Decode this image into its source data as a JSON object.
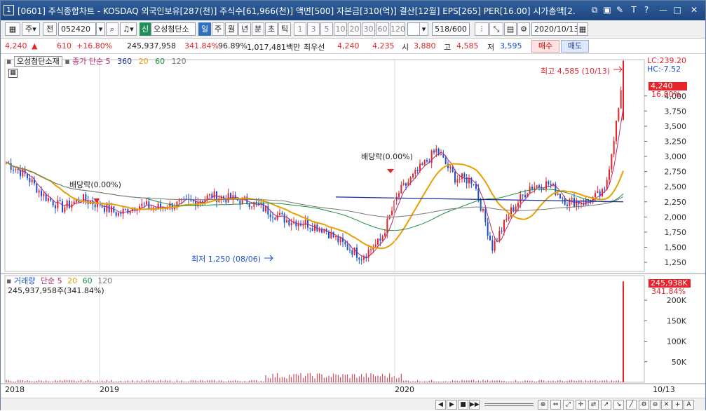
{
  "title": {
    "number": "1",
    "text": "[0601] 주식종합차트 - KOSDAQ 외국인보유[287(천)] 주식수[61,966(천)] 액면[500] 자본금[310(억)] 결산[12월] EPS[265] PER[16.00] 시가총액[2.",
    "buttons": [
      "⧉",
      "▣",
      "✎",
      "T",
      "?",
      "—",
      "□",
      "✕"
    ]
  },
  "toolbar": {
    "period_type": "주",
    "all_label": "전",
    "code": "052420",
    "stock_badge": "신",
    "stock_name": "오성첨단소",
    "periods": [
      "일",
      "주",
      "월",
      "년",
      "분",
      "초",
      "틱"
    ],
    "minute_steps": [
      "1",
      "3",
      "5",
      "10",
      "20",
      "30",
      "60",
      "120"
    ],
    "count": "518",
    "count_total": "/600",
    "date": "2020/10/13"
  },
  "quote": {
    "price": "4,240",
    "arrow": "▲",
    "change": "610",
    "change_pct": "+16.80%",
    "volume": "245,937,958",
    "volume_pct": "341.84%",
    "ratio": "96.89%",
    "amount": "1,017,481백만",
    "best_label": "최우선",
    "ask": "4,240",
    "bid": "4,235",
    "open_label": "시",
    "open": "3,880",
    "high_label": "고",
    "high": "4,585",
    "low_label": "저",
    "low": "3,595",
    "buy_label": "매수",
    "sell_label": "매도"
  },
  "price_panel": {
    "stock_tab": "오성첨단소재",
    "indicator_label": "종가 단순",
    "ma_periods": [
      "5",
      "360",
      "20",
      "60",
      "120"
    ],
    "lc": "LC:239.20",
    "hc": "HC:-7.52",
    "current_price": "4,240",
    "current_pct": "16.80%",
    "annotations": {
      "high": "최고 4,585 (10/13)",
      "low": "최저 1,250 (08/06)",
      "div1": "배당락(0.00%)",
      "div2": "배당락(0.00%)"
    }
  },
  "volume_panel": {
    "label": "거래량",
    "indicator_label": "단순",
    "ma_periods": [
      "5",
      "20",
      "60",
      "120"
    ],
    "value": "245,937,958주(341.84%)",
    "current": "245,938K",
    "current_pct": "341.84%"
  },
  "x_axis": [
    "2018",
    "2019",
    "2020",
    "10/13"
  ],
  "colors": {
    "ma5": "#b5266e",
    "ma20": "#e8a000",
    "ma60": "#1a8f3c",
    "ma120": "#777777",
    "ma360": "#1a2aa0",
    "candle_up": "#e8232a",
    "candle_down": "#1b4fd8",
    "tag_red": "#e8232a"
  },
  "chart_data": [
    {
      "type": "candlestick",
      "title": "오성첨단소재",
      "ylim": [
        1100,
        4600
      ],
      "y_ticks": [
        1250,
        1500,
        1750,
        2000,
        2250,
        2500,
        2750,
        3000,
        3250,
        3500,
        3750,
        4000
      ],
      "x_ticks": [
        "2018",
        "2019",
        "2020",
        "10/13"
      ],
      "series": [
        {
          "name": "종가",
          "points": [
            {
              "x": "2018-01",
              "y": 2900
            },
            {
              "x": "2018-02",
              "y": 2700
            },
            {
              "x": "2018-03",
              "y": 2350
            },
            {
              "x": "2018-04",
              "y": 2150
            },
            {
              "x": "2018-05",
              "y": 2300
            },
            {
              "x": "2018-06",
              "y": 2200
            },
            {
              "x": "2018-07",
              "y": 2050
            },
            {
              "x": "2018-08",
              "y": 2200
            },
            {
              "x": "2018-09",
              "y": 2150
            },
            {
              "x": "2018-10",
              "y": 2200
            },
            {
              "x": "2018-11",
              "y": 2250
            },
            {
              "x": "2018-12",
              "y": 2350
            },
            {
              "x": "2019-01",
              "y": 2300
            },
            {
              "x": "2019-02",
              "y": 2250
            },
            {
              "x": "2019-03",
              "y": 2100
            },
            {
              "x": "2019-04",
              "y": 1950
            },
            {
              "x": "2019-05",
              "y": 1900
            },
            {
              "x": "2019-06",
              "y": 1800
            },
            {
              "x": "2019-07",
              "y": 1550
            },
            {
              "x": "2019-08",
              "y": 1350
            },
            {
              "x": "2019-09",
              "y": 1600
            },
            {
              "x": "2019-10",
              "y": 2400
            },
            {
              "x": "2019-11",
              "y": 2750
            },
            {
              "x": "2019-12",
              "y": 3100
            },
            {
              "x": "2020-01",
              "y": 2650
            },
            {
              "x": "2020-02",
              "y": 2600
            },
            {
              "x": "2020-03",
              "y": 1500
            },
            {
              "x": "2020-04",
              "y": 2100
            },
            {
              "x": "2020-05",
              "y": 2500
            },
            {
              "x": "2020-06",
              "y": 2550
            },
            {
              "x": "2020-07",
              "y": 2250
            },
            {
              "x": "2020-08",
              "y": 2250
            },
            {
              "x": "2020-09",
              "y": 2400
            },
            {
              "x": "2020-10",
              "y": 4240
            }
          ]
        }
      ],
      "high": {
        "label": "최고",
        "value": 4585,
        "date": "10/13"
      },
      "low": {
        "label": "최저",
        "value": 1250,
        "date": "08/06"
      }
    },
    {
      "type": "bar",
      "title": "거래량",
      "unit": "K",
      "ylim": [
        0,
        260000
      ],
      "y_ticks": [
        50000,
        100000,
        150000,
        200000
      ],
      "current": 245938
    }
  ]
}
